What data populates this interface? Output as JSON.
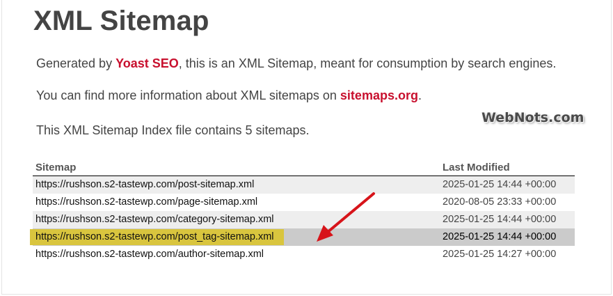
{
  "page": {
    "title": "XML Sitemap",
    "intro_prefix": "Generated by ",
    "intro_link": "Yoast SEO",
    "intro_suffix": ", this is an XML Sitemap, meant for consumption by search engines.",
    "info_prefix": "You can find more information about XML sitemaps on ",
    "info_link": "sitemaps.org",
    "info_suffix": ".",
    "count_text": "This XML Sitemap Index file contains 5 sitemaps.",
    "watermark": "WebNots.com"
  },
  "table": {
    "headers": [
      "Sitemap",
      "Last Modified"
    ],
    "rows": [
      {
        "url": "https://rushson.s2-tastewp.com/post-sitemap.xml",
        "modified": "2025-01-25 14:44 +00:00"
      },
      {
        "url": "https://rushson.s2-tastewp.com/page-sitemap.xml",
        "modified": "2020-08-05 23:33 +00:00"
      },
      {
        "url": "https://rushson.s2-tastewp.com/category-sitemap.xml",
        "modified": "2025-01-25 14:44 +00:00"
      },
      {
        "url": "https://rushson.s2-tastewp.com/post_tag-sitemap.xml",
        "modified": "2025-01-25 14:44 +00:00"
      },
      {
        "url": "https://rushson.s2-tastewp.com/author-sitemap.xml",
        "modified": "2025-01-25 14:27 +00:00"
      }
    ]
  },
  "colors": {
    "link": "#c8102e",
    "highlight": "#d9c53e",
    "arrow": "#d7141a"
  },
  "icons": {
    "annotation": "red-arrow-icon"
  }
}
